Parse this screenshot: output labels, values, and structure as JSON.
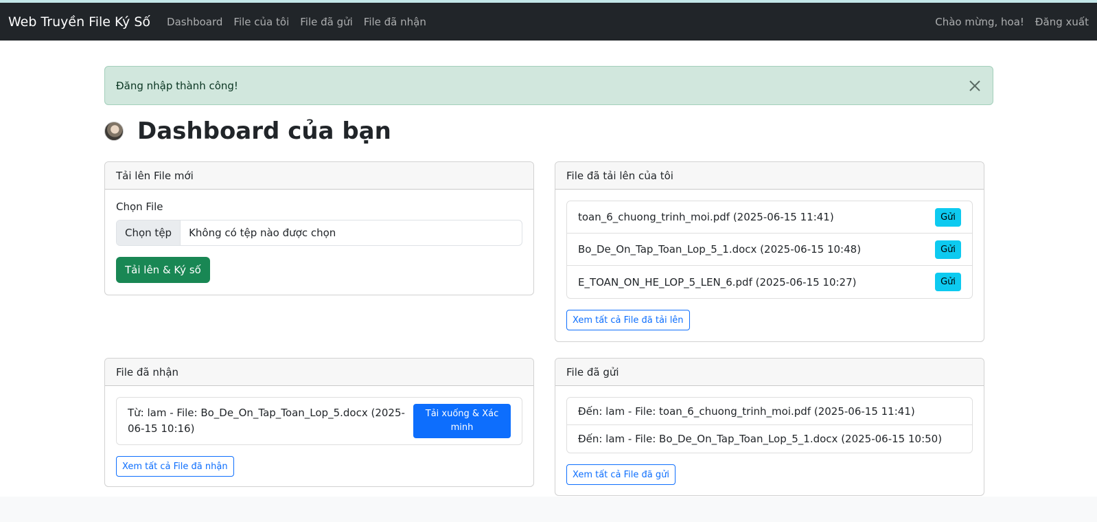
{
  "navbar": {
    "brand": "Web Truyền File Ký Số",
    "links": [
      "Dashboard",
      "File của tôi",
      "File đã gửi",
      "File đã nhận"
    ],
    "welcome": "Chào mừng, hoa!",
    "logout": "Đăng xuất"
  },
  "alert": {
    "message": "Đăng nhập thành công!"
  },
  "page": {
    "title": "Dashboard của bạn"
  },
  "upload": {
    "header": "Tải lên File mới",
    "label": "Chọn File",
    "choose_button": "Chọn tệp",
    "no_file_text": "Không có tệp nào được chọn",
    "submit": "Tải lên & Ký số"
  },
  "uploaded": {
    "header": "File đã tải lên của tôi",
    "items": [
      {
        "text": "toan_6_chuong_trinh_moi.pdf (2025-06-15 11:41)",
        "button": "Gửi"
      },
      {
        "text": "Bo_De_On_Tap_Toan_Lop_5_1.docx (2025-06-15 10:48)",
        "button": "Gửi"
      },
      {
        "text": "E_TOAN_ON_HE_LOP_5_LEN_6.pdf (2025-06-15 10:27)",
        "button": "Gửi"
      }
    ],
    "view_all": "Xem tất cả File đã tải lên"
  },
  "received": {
    "header": "File đã nhận",
    "items": [
      {
        "text": "Từ: lam - File: Bo_De_On_Tap_Toan_Lop_5.docx (2025-06-15 10:16)",
        "button": "Tải xuống & Xác minh"
      }
    ],
    "view_all": "Xem tất cả File đã nhận"
  },
  "sent": {
    "header": "File đã gửi",
    "items": [
      {
        "text": "Đến: lam - File: toan_6_chuong_trinh_moi.pdf (2025-06-15 11:41)"
      },
      {
        "text": "Đến: lam - File: Bo_De_On_Tap_Toan_Lop_5_1.docx (2025-06-15 10:50)"
      }
    ],
    "view_all": "Xem tất cả File đã gửi"
  }
}
